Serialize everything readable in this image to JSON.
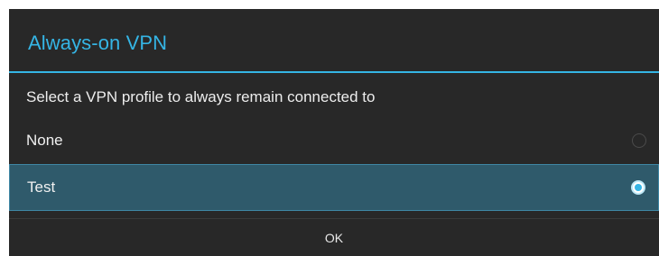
{
  "dialog": {
    "title": "Always-on VPN",
    "message": "Select a VPN profile to always remain connected to",
    "options": [
      {
        "label": "None",
        "selected": false
      },
      {
        "label": "Test",
        "selected": true
      }
    ],
    "ok_label": "OK"
  },
  "colors": {
    "accent": "#35b5e5",
    "dialog_background": "#282828",
    "selected_row": "#2f5a6b"
  },
  "icons": {
    "unchecked_radio": "radio-unchecked-icon",
    "checked_radio": "radio-checked-icon"
  }
}
